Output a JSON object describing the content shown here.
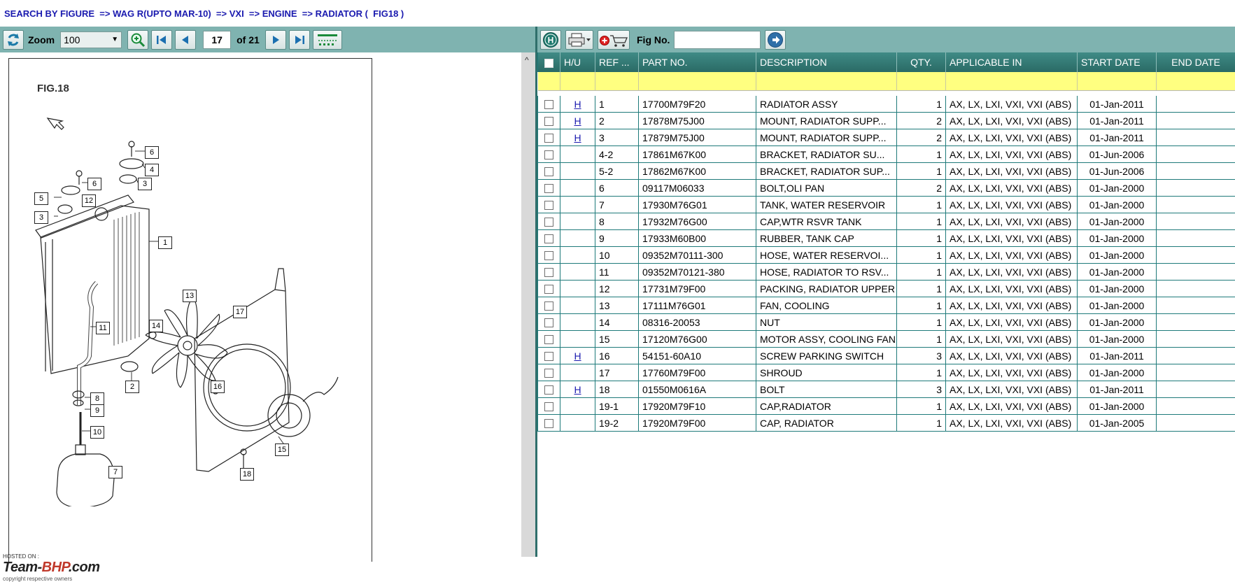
{
  "breadcrumb": {
    "label": "SEARCH BY FIGURE",
    "items": [
      "WAG R(UPTO MAR-10)",
      "VXI",
      "ENGINE",
      "RADIATOR (  FIG18 )"
    ]
  },
  "viewer": {
    "zoom_label": "Zoom",
    "zoom_value": "100",
    "current_page": "17",
    "page_total": "of 21",
    "figure_title": "FIG.18"
  },
  "callouts": [
    "6",
    "4",
    "3",
    "6",
    "5",
    "12",
    "3",
    "1",
    "13",
    "14",
    "17",
    "11",
    "2",
    "16",
    "8",
    "9",
    "10",
    "15",
    "7",
    "18"
  ],
  "watermark": {
    "hosted": "HOSTED ON :",
    "brand_a": "Team-",
    "brand_b": "BHP",
    "brand_c": ".com",
    "copyright": "copyright respective owners"
  },
  "parts_toolbar": {
    "figno_label": "Fig No."
  },
  "table": {
    "headers": [
      "H/U",
      "REF ...",
      "PART NO.",
      "DESCRIPTION",
      "QTY.",
      "APPLICABLE IN",
      "START DATE",
      "END DATE"
    ],
    "rows": [
      {
        "hu": "H",
        "ref": "1",
        "part": "17700M79F20",
        "desc": "RADIATOR ASSY",
        "qty": "1",
        "app": "AX, LX, LXI, VXI, VXI (ABS)",
        "start": "01-Jan-2011",
        "end": ""
      },
      {
        "hu": "H",
        "ref": "2",
        "part": "17878M75J00",
        "desc": "MOUNT, RADIATOR SUPP...",
        "qty": "2",
        "app": "AX, LX, LXI, VXI, VXI (ABS)",
        "start": "01-Jan-2011",
        "end": ""
      },
      {
        "hu": "H",
        "ref": "3",
        "part": "17879M75J00",
        "desc": "MOUNT, RADIATOR SUPP...",
        "qty": "2",
        "app": "AX, LX, LXI, VXI, VXI (ABS)",
        "start": "01-Jan-2011",
        "end": ""
      },
      {
        "hu": "",
        "ref": "4-2",
        "part": "17861M67K00",
        "desc": "BRACKET,  RADIATOR  SU...",
        "qty": "1",
        "app": "AX, LX, LXI, VXI, VXI (ABS)",
        "start": "01-Jun-2006",
        "end": ""
      },
      {
        "hu": "",
        "ref": "5-2",
        "part": "17862M67K00",
        "desc": "BRACKET, RADIATOR SUP...",
        "qty": "1",
        "app": "AX, LX, LXI, VXI, VXI (ABS)",
        "start": "01-Jun-2006",
        "end": ""
      },
      {
        "hu": "",
        "ref": "6",
        "part": "09117M06033",
        "desc": "BOLT,OLI PAN",
        "qty": "2",
        "app": "AX, LX, LXI, VXI, VXI (ABS)",
        "start": "01-Jan-2000",
        "end": ""
      },
      {
        "hu": "",
        "ref": "7",
        "part": "17930M76G01",
        "desc": "TANK, WATER RESERVOIR",
        "qty": "1",
        "app": "AX, LX, LXI, VXI, VXI (ABS)",
        "start": "01-Jan-2000",
        "end": ""
      },
      {
        "hu": "",
        "ref": "8",
        "part": "17932M76G00",
        "desc": "CAP,WTR RSVR TANK",
        "qty": "1",
        "app": "AX, LX, LXI, VXI, VXI (ABS)",
        "start": "01-Jan-2000",
        "end": ""
      },
      {
        "hu": "",
        "ref": "9",
        "part": "17933M60B00",
        "desc": "RUBBER, TANK CAP",
        "qty": "1",
        "app": "AX, LX, LXI, VXI, VXI (ABS)",
        "start": "01-Jan-2000",
        "end": ""
      },
      {
        "hu": "",
        "ref": "10",
        "part": "09352M70111-300",
        "desc": "HOSE, WATER RESERVOI...",
        "qty": "1",
        "app": "AX, LX, LXI, VXI, VXI (ABS)",
        "start": "01-Jan-2000",
        "end": ""
      },
      {
        "hu": "",
        "ref": "11",
        "part": "09352M70121-380",
        "desc": "HOSE, RADIATOR TO RSV...",
        "qty": "1",
        "app": "AX, LX, LXI, VXI, VXI (ABS)",
        "start": "01-Jan-2000",
        "end": ""
      },
      {
        "hu": "",
        "ref": "12",
        "part": "17731M79F00",
        "desc": "PACKING, RADIATOR UPPER",
        "qty": "1",
        "app": "AX, LX, LXI, VXI, VXI (ABS)",
        "start": "01-Jan-2000",
        "end": ""
      },
      {
        "hu": "",
        "ref": "13",
        "part": "17111M76G01",
        "desc": "FAN, COOLING",
        "qty": "1",
        "app": "AX, LX, LXI, VXI, VXI (ABS)",
        "start": "01-Jan-2000",
        "end": ""
      },
      {
        "hu": "",
        "ref": "14",
        "part": "08316-20053",
        "desc": "NUT",
        "qty": "1",
        "app": "AX, LX, LXI, VXI, VXI (ABS)",
        "start": "01-Jan-2000",
        "end": ""
      },
      {
        "hu": "",
        "ref": "15",
        "part": "17120M76G00",
        "desc": "MOTOR ASSY, COOLING FAN",
        "qty": "1",
        "app": "AX, LX, LXI, VXI, VXI (ABS)",
        "start": "01-Jan-2000",
        "end": ""
      },
      {
        "hu": "H",
        "ref": "16",
        "part": "54151-60A10",
        "desc": "SCREW PARKING SWITCH",
        "qty": "3",
        "app": "AX, LX, LXI, VXI, VXI (ABS)",
        "start": "01-Jan-2011",
        "end": ""
      },
      {
        "hu": "",
        "ref": "17",
        "part": "17760M79F00",
        "desc": "SHROUD",
        "qty": "1",
        "app": "AX, LX, LXI, VXI, VXI (ABS)",
        "start": "01-Jan-2000",
        "end": ""
      },
      {
        "hu": "H",
        "ref": "18",
        "part": "01550M0616A",
        "desc": "BOLT",
        "qty": "3",
        "app": "AX, LX, LXI, VXI, VXI (ABS)",
        "start": "01-Jan-2011",
        "end": ""
      },
      {
        "hu": "",
        "ref": "19-1",
        "part": "17920M79F10",
        "desc": "CAP,RADIATOR",
        "qty": "1",
        "app": "AX, LX, LXI, VXI, VXI (ABS)",
        "start": "01-Jan-2000",
        "end": ""
      },
      {
        "hu": "",
        "ref": "19-2",
        "part": "17920M79F00",
        "desc": "CAP, RADIATOR",
        "qty": "1",
        "app": "AX, LX, LXI, VXI, VXI (ABS)",
        "start": "01-Jan-2005",
        "end": ""
      }
    ]
  },
  "colors": {
    "toolbar": "#7fb3b0",
    "header": "#2a6a65",
    "filter_row": "#ffff80",
    "link": "#1a1aaf"
  }
}
